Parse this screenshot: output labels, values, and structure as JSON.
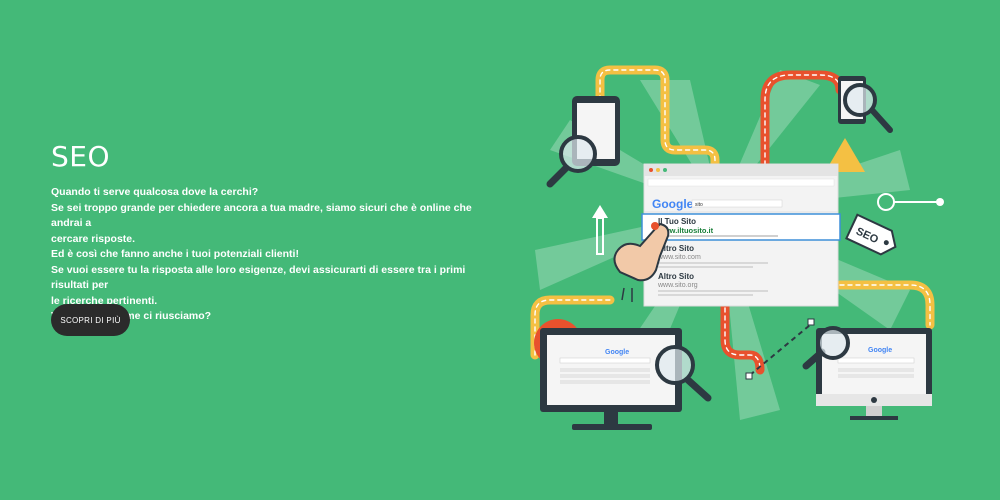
{
  "hero": {
    "title": "SEO",
    "paragraphs": [
      "Quando ti serve qualcosa dove la cerchi?",
      "Se sei troppo grande per chiedere ancora a tua madre, siamo sicuri che è online che andrai a",
      "cercare risposte.",
      "Ed è così che fanno anche i tuoi potenziali clienti!",
      "Se vuoi essere tu la risposta alle loro esigenze, devi assicurarti di essere tra i primi risultati per",
      "le ricerche pertinenti.",
      "Vuoi sapere come ci riusciamo?"
    ],
    "cta_label": "SCOPRI DI PIÙ"
  },
  "illustration": {
    "search_engine_logo": "Google",
    "query": "sito",
    "results": [
      {
        "title": "Il Tuo Sito",
        "url": "www.iltuosito.it",
        "highlighted": true
      },
      {
        "title": "Altro Sito",
        "url": "www.sito.com",
        "highlighted": false
      },
      {
        "title": "Altro Sito",
        "url": "www.sito.org",
        "highlighted": false
      }
    ],
    "tag_label": "SEO",
    "icons": [
      "magnifier-icon",
      "hand-pointer-icon",
      "price-tag-icon",
      "arrow-up-icon"
    ]
  },
  "colors": {
    "background": "#44b978",
    "button": "#2b2b2b",
    "road_orange": "#e8512d",
    "road_yellow": "#f4c043",
    "dark": "#2d3942",
    "highlight_blue": "#3d8fd8",
    "url_green": "#1a7f3a"
  }
}
